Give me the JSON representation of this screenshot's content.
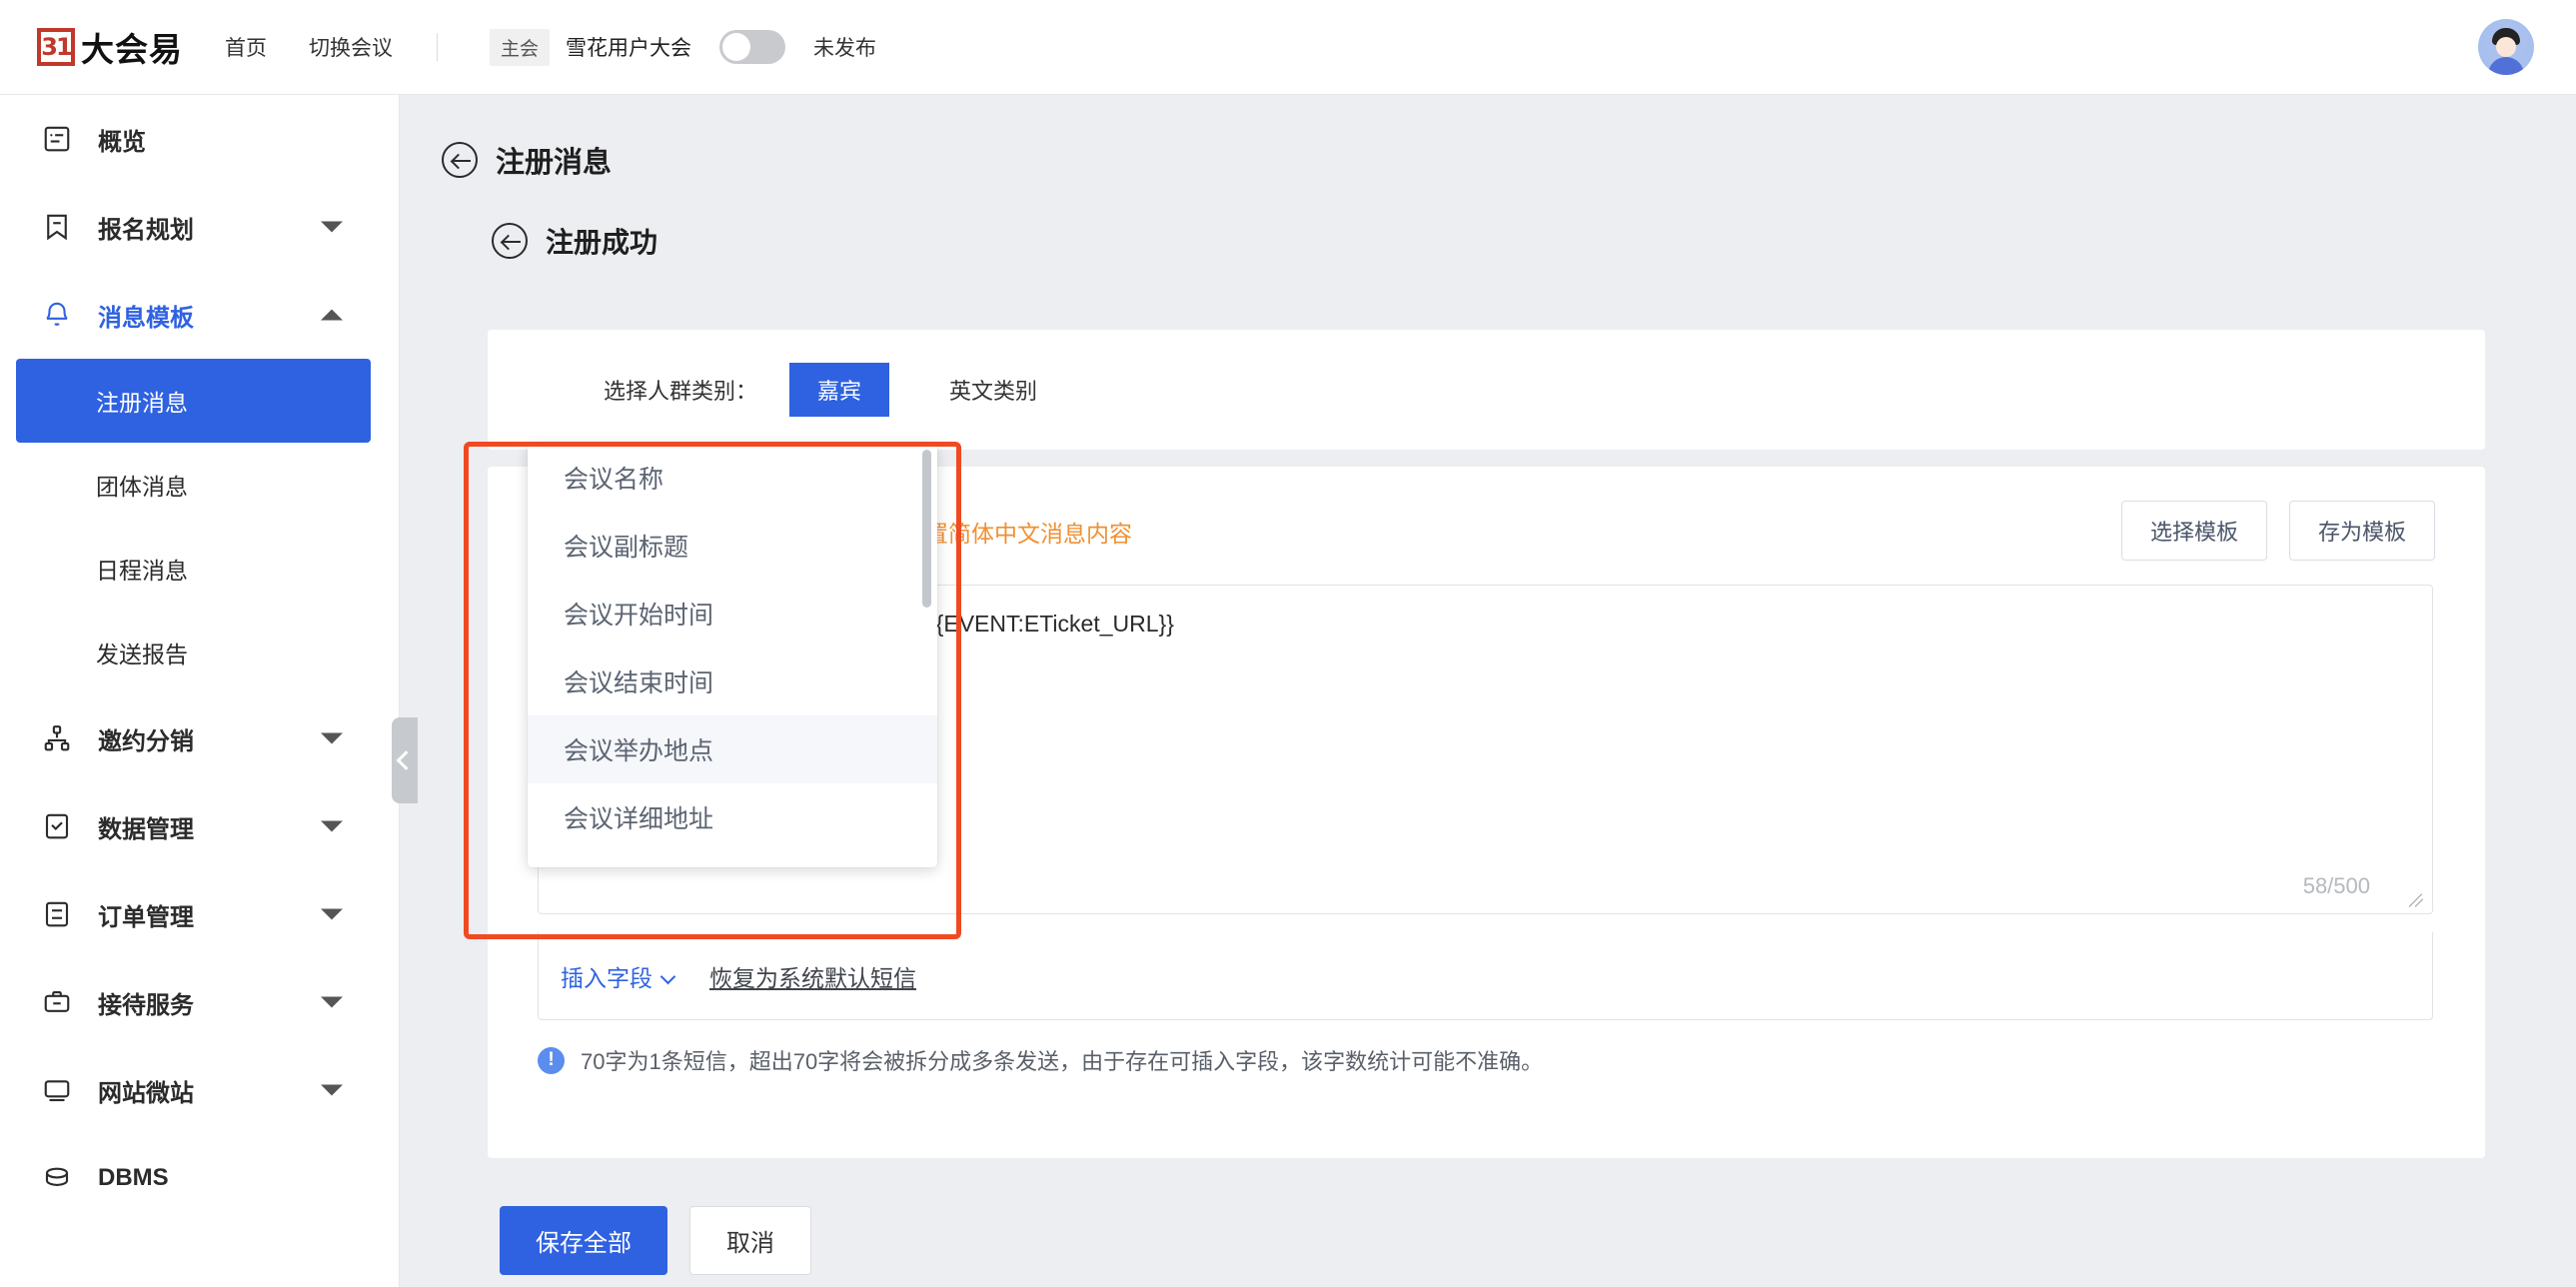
{
  "topbar": {
    "logo_badge": "31",
    "logo_text": "大会易",
    "nav": [
      {
        "label": "首页"
      },
      {
        "label": "切换会议"
      }
    ],
    "conference_tag": "主会",
    "conference_name": "雪花用户大会",
    "publish_status": "未发布",
    "toggle_state": "off",
    "avatar_name": "user-avatar"
  },
  "sidebar": {
    "items": [
      {
        "label": "概览",
        "icon": "overview-icon",
        "expandable": false
      },
      {
        "label": "报名规划",
        "icon": "bookmark-icon",
        "expandable": true
      },
      {
        "label": "消息模板",
        "icon": "bell-icon",
        "expandable": true,
        "active": true
      }
    ],
    "sub_items": [
      {
        "label": "注册消息",
        "selected": true
      },
      {
        "label": "团体消息",
        "selected": false
      },
      {
        "label": "日程消息",
        "selected": false
      },
      {
        "label": "发送报告",
        "selected": false
      }
    ],
    "items_lower": [
      {
        "label": "邀约分销",
        "icon": "share-nodes-icon",
        "expandable": true
      },
      {
        "label": "数据管理",
        "icon": "clipboard-check-icon",
        "expandable": true
      },
      {
        "label": "订单管理",
        "icon": "list-icon",
        "expandable": true
      },
      {
        "label": "接待服务",
        "icon": "briefcase-icon",
        "expandable": true
      },
      {
        "label": "网站微站",
        "icon": "monitor-icon",
        "expandable": true
      },
      {
        "label": "DBMS",
        "icon": "database-icon",
        "expandable": false
      }
    ]
  },
  "main": {
    "page_title": "注册消息",
    "sub_title": "注册成功",
    "category": {
      "label": "选择人群类别：",
      "tabs": [
        {
          "label": "嘉宾",
          "selected": true
        },
        {
          "label": "英文类别",
          "selected": false
        }
      ]
    },
    "warning": "人群类别语言为简体中文，请设置简体中文消息内容",
    "template_buttons": [
      {
        "label": "选择模板"
      },
      {
        "label": "存为模板"
      }
    ],
    "editor": {
      "value": "，您可以点击下方链接查看电子票，{{EVENT:ETicket_URL}}",
      "char_count": "58/500"
    },
    "insert_field_label": "插入字段",
    "restore_default_label": "恢复为系统默认短信",
    "tip_icon": "!",
    "tip_text": "70字为1条短信，超出70字将会被拆分成多条发送，由于存在可插入字段，该字数统计可能不准确。",
    "footer": {
      "save_label": "保存全部",
      "cancel_label": "取消"
    }
  },
  "dropdown": {
    "items": [
      {
        "label": "会议名称",
        "hover": false
      },
      {
        "label": "会议副标题",
        "hover": false
      },
      {
        "label": "会议开始时间",
        "hover": false
      },
      {
        "label": "会议结束时间",
        "hover": false
      },
      {
        "label": "会议举办地点",
        "hover": true
      },
      {
        "label": "会议详细地址",
        "hover": false
      }
    ]
  },
  "colors": {
    "accent": "#2f62e0",
    "warning": "#ef9033",
    "annotation": "#f04a23",
    "page_bg": "#eceef1"
  }
}
